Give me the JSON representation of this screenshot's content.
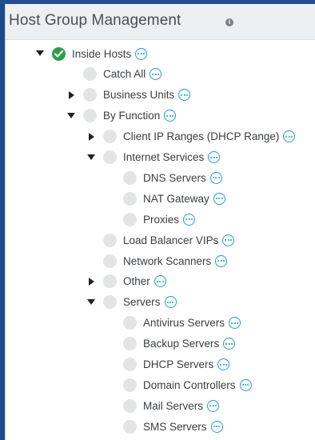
{
  "header": {
    "title": "Host Group Management"
  },
  "tree": [
    {
      "label": "Inside Hosts",
      "level": 0,
      "expander": "expanded",
      "status": "check"
    },
    {
      "label": "Catch All",
      "level": 1,
      "expander": "none",
      "status": "dot"
    },
    {
      "label": "Business Units",
      "level": 1,
      "expander": "collapsed",
      "status": "dot"
    },
    {
      "label": "By Function",
      "level": 1,
      "expander": "expanded",
      "status": "dot"
    },
    {
      "label": "Client IP Ranges (DHCP Range)",
      "level": 2,
      "expander": "collapsed",
      "status": "dot"
    },
    {
      "label": "Internet Services",
      "level": 2,
      "expander": "expanded",
      "status": "dot"
    },
    {
      "label": "DNS Servers",
      "level": 3,
      "expander": "none",
      "status": "dot"
    },
    {
      "label": "NAT Gateway",
      "level": 3,
      "expander": "none",
      "status": "dot"
    },
    {
      "label": "Proxies",
      "level": 3,
      "expander": "none",
      "status": "dot"
    },
    {
      "label": "Load Balancer VIPs",
      "level": 2,
      "expander": "none",
      "status": "dot"
    },
    {
      "label": "Network Scanners",
      "level": 2,
      "expander": "none",
      "status": "dot"
    },
    {
      "label": "Other",
      "level": 2,
      "expander": "collapsed",
      "status": "dot"
    },
    {
      "label": "Servers",
      "level": 2,
      "expander": "expanded",
      "status": "dot"
    },
    {
      "label": "Antivirus Servers",
      "level": 3,
      "expander": "none",
      "status": "dot"
    },
    {
      "label": "Backup Servers",
      "level": 3,
      "expander": "none",
      "status": "dot"
    },
    {
      "label": "DHCP Servers",
      "level": 3,
      "expander": "none",
      "status": "dot"
    },
    {
      "label": "Domain Controllers",
      "level": 3,
      "expander": "none",
      "status": "dot"
    },
    {
      "label": "Mail Servers",
      "level": 3,
      "expander": "none",
      "status": "dot"
    },
    {
      "label": "SMS Servers",
      "level": 3,
      "expander": "none",
      "status": "dot"
    }
  ],
  "icons": {
    "header_info": "info-icon",
    "row_action": "more-options-icon",
    "expanded": "caret-down-icon",
    "collapsed": "caret-right-icon",
    "status": "check-circle-icon"
  },
  "colors": {
    "accent": "#1d9bd8",
    "success": "#2aa04a",
    "frame": "#1f4e93"
  }
}
